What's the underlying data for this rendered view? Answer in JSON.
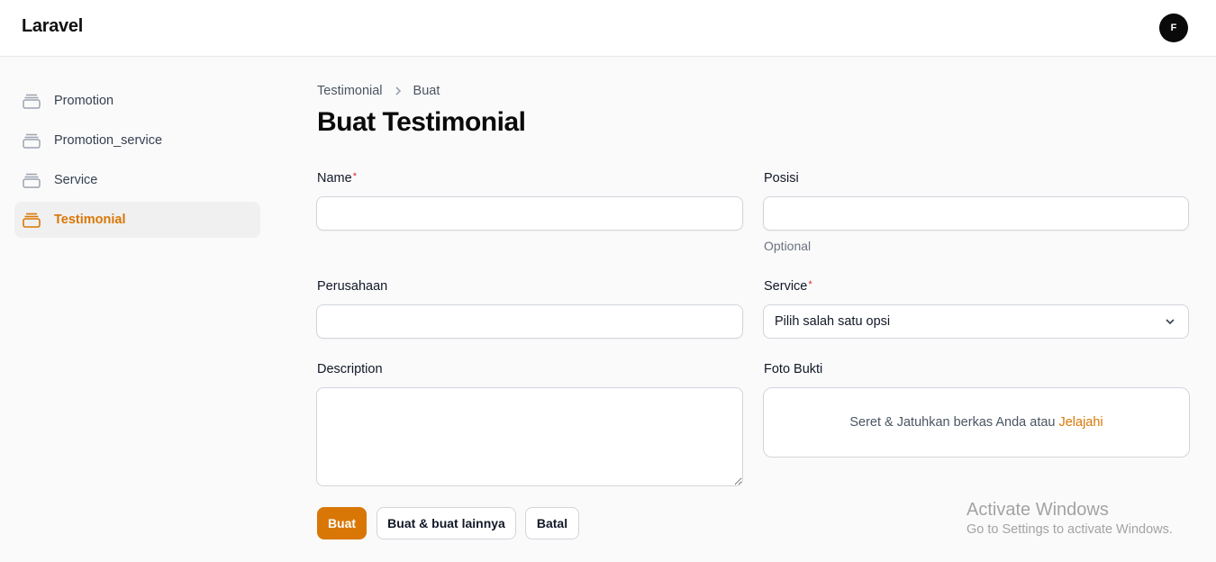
{
  "app": {
    "brand": "Laravel",
    "avatar_initial": "F"
  },
  "colors": {
    "accent": "#d97706",
    "required": "#dc2626"
  },
  "sidebar": {
    "items": [
      {
        "label": "Promotion",
        "icon": "rectangle-stack-icon",
        "active": false
      },
      {
        "label": "Promotion_service",
        "icon": "rectangle-stack-icon",
        "active": false
      },
      {
        "label": "Service",
        "icon": "rectangle-stack-icon",
        "active": false
      },
      {
        "label": "Testimonial",
        "icon": "rectangle-stack-icon",
        "active": true
      }
    ]
  },
  "breadcrumb": {
    "parent": "Testimonial",
    "current": "Buat"
  },
  "page": {
    "title": "Buat Testimonial"
  },
  "form": {
    "name": {
      "label": "Name",
      "required_mark": "*",
      "value": ""
    },
    "posisi": {
      "label": "Posisi",
      "value": "",
      "hint": "Optional"
    },
    "perusahaan": {
      "label": "Perusahaan",
      "value": ""
    },
    "service": {
      "label": "Service",
      "required_mark": "*",
      "selected": "Pilih salah satu opsi"
    },
    "description": {
      "label": "Description",
      "value": ""
    },
    "foto_bukti": {
      "label": "Foto Bukti",
      "prompt": "Seret & Jatuhkan berkas Anda atau",
      "browse": "Jelajahi"
    }
  },
  "actions": {
    "create": "Buat",
    "create_another": "Buat & buat lainnya",
    "cancel": "Batal"
  },
  "watermark": {
    "title": "Activate Windows",
    "subtitle": "Go to Settings to activate Windows."
  }
}
